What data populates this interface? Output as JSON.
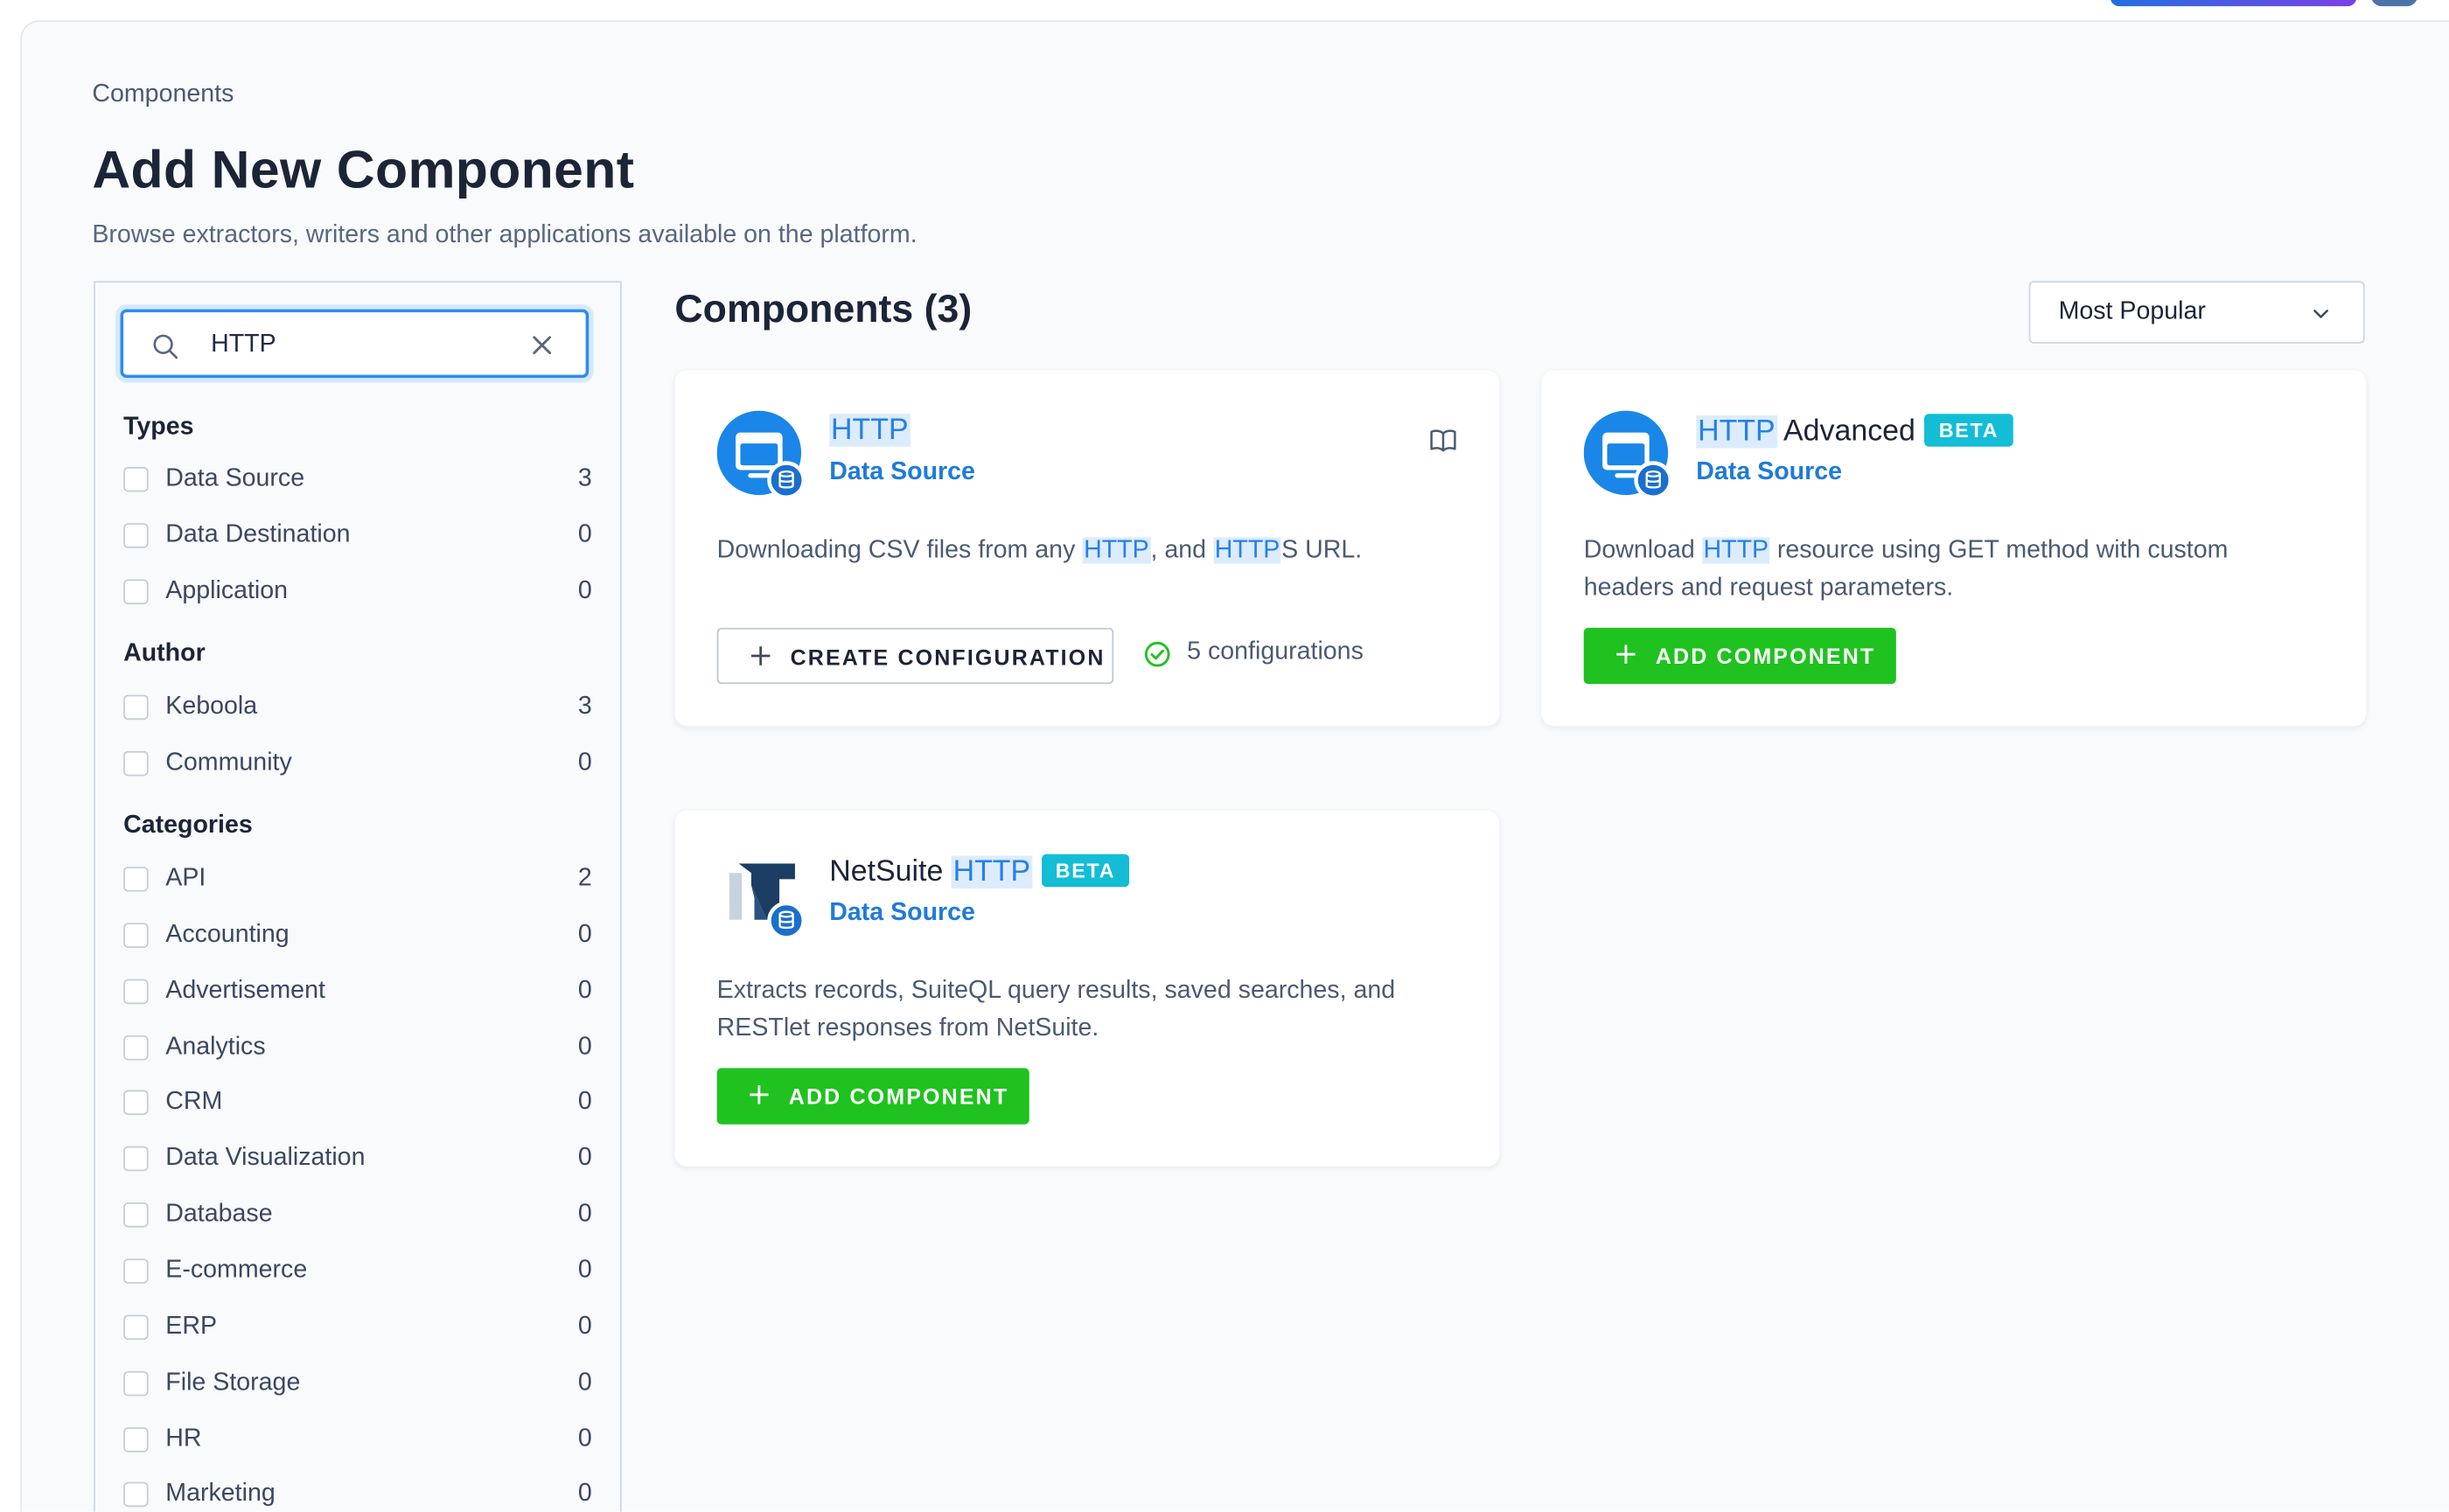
{
  "breadcrumb": "Components",
  "page": {
    "title": "Add New Component",
    "subtitle": "Browse extractors, writers and other applications available on the platform."
  },
  "search": {
    "value": "HTTP"
  },
  "filters": {
    "types": {
      "heading": "Types",
      "items": [
        {
          "label": "Data Source",
          "count": "3"
        },
        {
          "label": "Data Destination",
          "count": "0"
        },
        {
          "label": "Application",
          "count": "0"
        }
      ]
    },
    "author": {
      "heading": "Author",
      "items": [
        {
          "label": "Keboola",
          "count": "3"
        },
        {
          "label": "Community",
          "count": "0"
        }
      ]
    },
    "categories": {
      "heading": "Categories",
      "items": [
        {
          "label": "API",
          "count": "2"
        },
        {
          "label": "Accounting",
          "count": "0"
        },
        {
          "label": "Advertisement",
          "count": "0"
        },
        {
          "label": "Analytics",
          "count": "0"
        },
        {
          "label": "CRM",
          "count": "0"
        },
        {
          "label": "Data Visualization",
          "count": "0"
        },
        {
          "label": "Database",
          "count": "0"
        },
        {
          "label": "E-commerce",
          "count": "0"
        },
        {
          "label": "ERP",
          "count": "0"
        },
        {
          "label": "File Storage",
          "count": "0"
        },
        {
          "label": "HR",
          "count": "0"
        },
        {
          "label": "Marketing",
          "count": "0"
        }
      ]
    }
  },
  "components": {
    "heading": "Components (3)",
    "sort": "Most Popular",
    "cards": [
      {
        "title_highlight": "HTTP",
        "title_rest": "",
        "badge": "",
        "type": "Data Source",
        "description": [
          {
            "text": "Downloading CSV files from any ",
            "hl": false
          },
          {
            "text": "HTTP",
            "hl": true
          },
          {
            "text": ", and ",
            "hl": false
          },
          {
            "text": "HTTP",
            "hl": true
          },
          {
            "text": "S URL.",
            "hl": false
          }
        ],
        "action": "CREATE CONFIGURATION",
        "configurations": "5 configurations"
      },
      {
        "title_highlight": "HTTP",
        "title_rest": " Advanced",
        "badge": "BETA",
        "type": "Data Source",
        "description": [
          {
            "text": "Download ",
            "hl": false
          },
          {
            "text": "HTTP",
            "hl": true
          },
          {
            "text": " resource using GET method with custom headers and request parameters.",
            "hl": false
          }
        ],
        "action": "ADD COMPONENT"
      },
      {
        "title_prefix": "NetSuite ",
        "title_highlight": "HTTP",
        "badge": "BETA",
        "type": "Data Source",
        "description": [
          {
            "text": "Extracts records, SuiteQL query results, saved searches, and RESTlet responses from NetSuite.",
            "hl": false
          }
        ],
        "action": "ADD COMPONENT"
      }
    ]
  },
  "colors": {
    "accent": "#2c8cf0",
    "green": "#1fc21f",
    "beta": "#13bdd6",
    "link": "#1e7bd8"
  },
  "icons": {
    "search": "search-icon",
    "clear": "close-icon",
    "sort": "chevron-down-icon",
    "docs": "book-icon",
    "check": "check-circle-icon",
    "plus": "plus-icon",
    "http": "http-browser-icon",
    "netsuite": "netsuite-logo-icon",
    "db": "database-icon"
  }
}
